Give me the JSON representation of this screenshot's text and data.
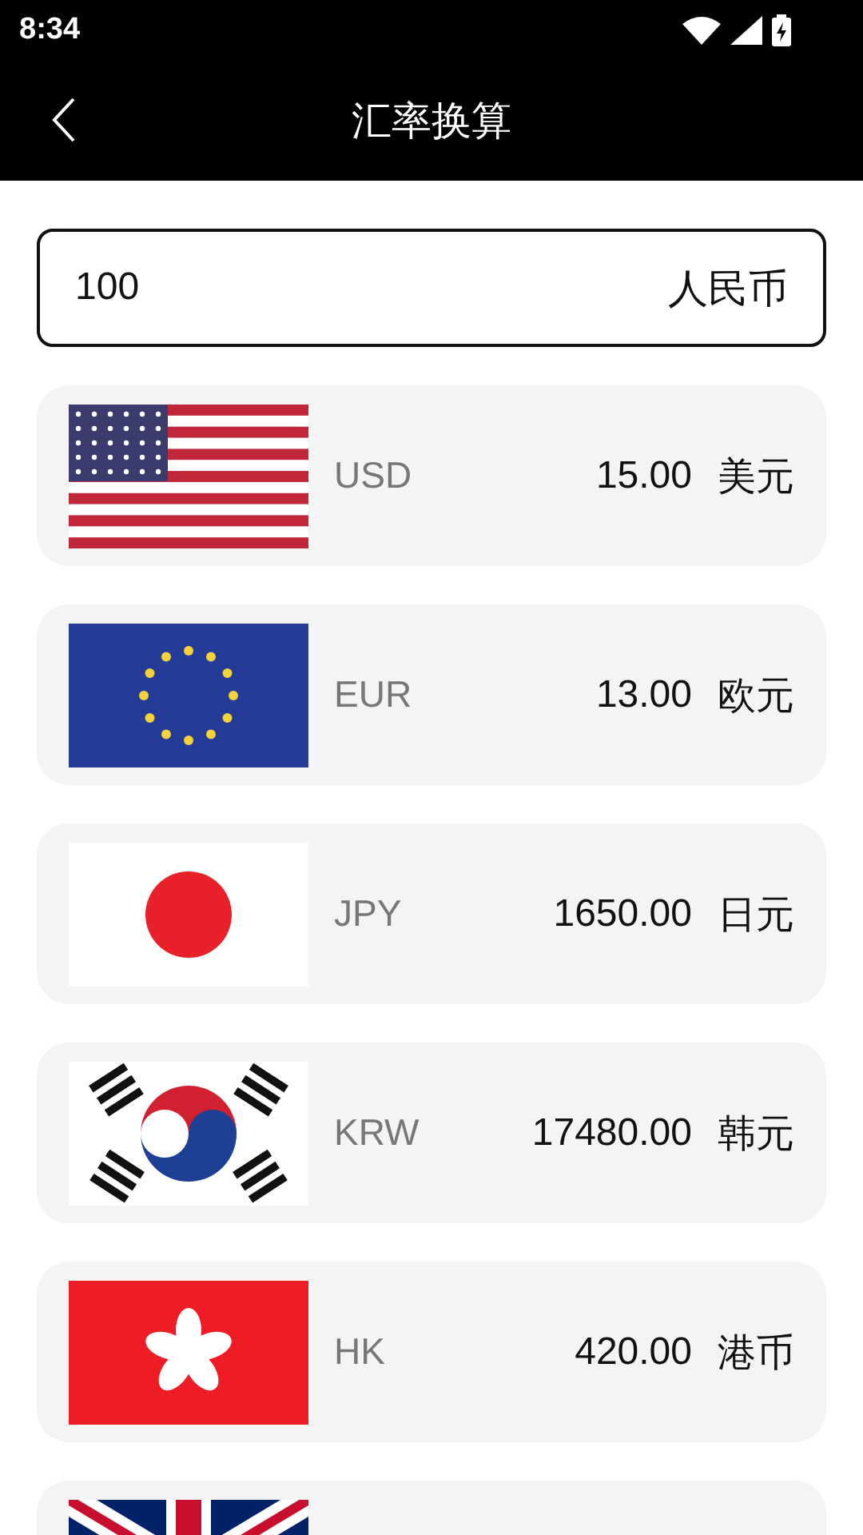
{
  "status_bar": {
    "time": "8:34"
  },
  "header": {
    "title": "汇率换算"
  },
  "input": {
    "value": "100",
    "currency": "人民币"
  },
  "rates": [
    {
      "kind": "us",
      "code": "USD",
      "amount": "15.00",
      "name": "美元"
    },
    {
      "kind": "eu",
      "code": "EUR",
      "amount": "13.00",
      "name": "欧元"
    },
    {
      "kind": "jp",
      "code": "JPY",
      "amount": "1650.00",
      "name": "日元"
    },
    {
      "kind": "kr",
      "code": "KRW",
      "amount": "17480.00",
      "name": "韩元"
    },
    {
      "kind": "hk",
      "code": "HK",
      "amount": "420.00",
      "name": "港币"
    },
    {
      "kind": "gb"
    }
  ]
}
